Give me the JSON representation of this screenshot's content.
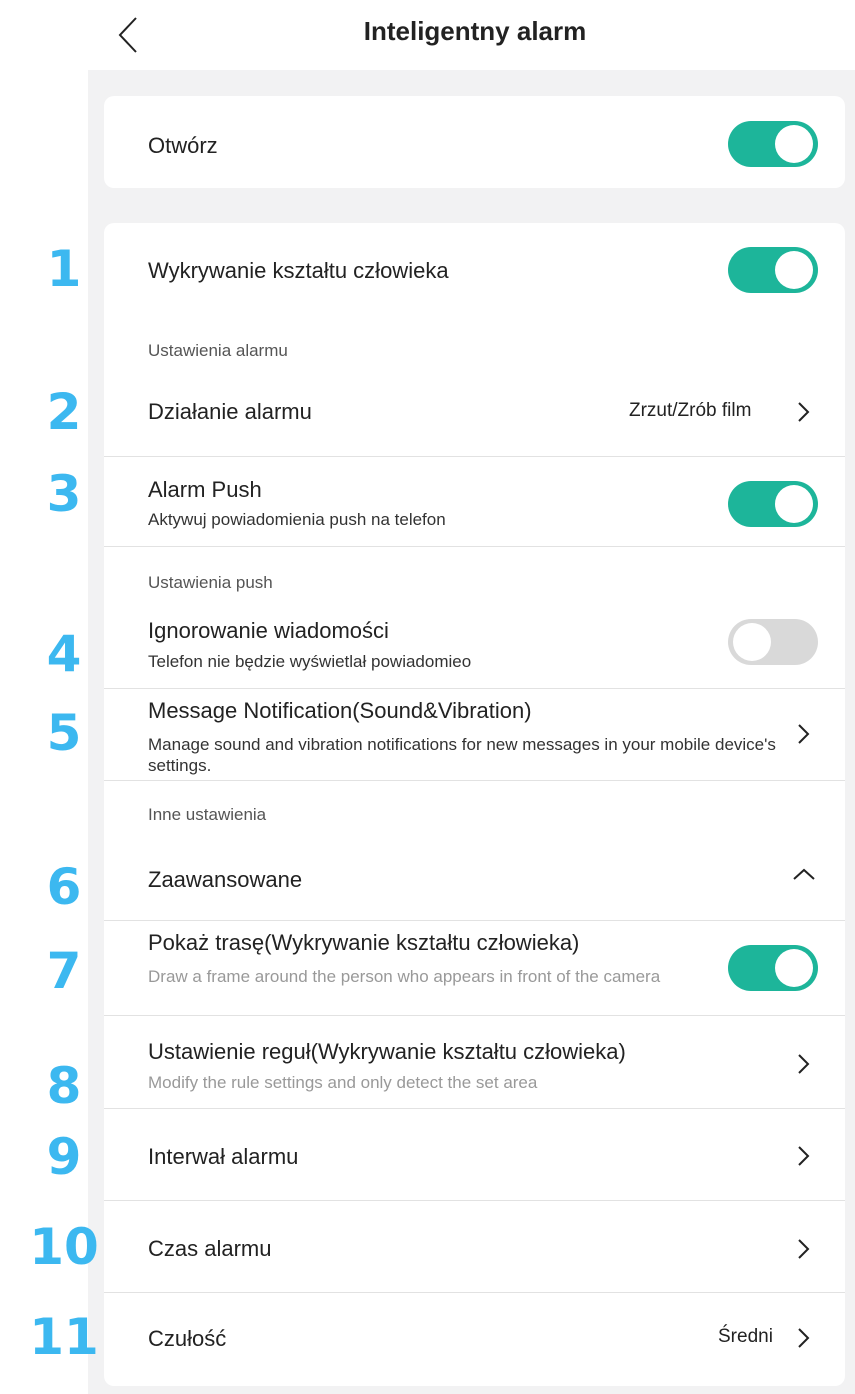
{
  "header": {
    "title": "Inteligentny alarm"
  },
  "open": {
    "label": "Otwórz",
    "state": "on"
  },
  "labels": [
    "1",
    "2",
    "3",
    "4",
    "5",
    "6",
    "7",
    "8",
    "9",
    "10",
    "11"
  ],
  "rows": {
    "human_detect": {
      "title": "Wykrywanie kształtu człowieka",
      "state": "on"
    },
    "alarm_settings_head": "Ustawienia alarmu",
    "alarm_action": {
      "title": "Działanie alarmu",
      "value": "Zrzut/Zrób film"
    },
    "alarm_push": {
      "title": "Alarm Push",
      "subtitle": "Aktywuj powiadomienia push na telefon",
      "state": "on"
    },
    "push_settings_head": "Ustawienia push",
    "ignore_messages": {
      "title": "Ignorowanie wiadomości",
      "subtitle": "Telefon nie będzie wyświetlał powiadomieo",
      "state": "off"
    },
    "message_notification": {
      "title": "Message Notification(Sound&Vibration)",
      "subtitle": "Manage sound and vibration notifications for new messages in your mobile device's settings."
    },
    "other_settings_head": "Inne ustawienia",
    "advanced": {
      "title": "Zaawansowane"
    },
    "show_track": {
      "title": "Pokaż trasę(Wykrywanie kształtu człowieka)",
      "subtitle": "Draw a frame around the person who appears in front of the camera",
      "state": "on"
    },
    "rule_settings": {
      "title": "Ustawienie reguł(Wykrywanie kształtu człowieka)",
      "subtitle": "Modify the rule settings and only detect the set area"
    },
    "alarm_interval": {
      "title": "Interwał alarmu"
    },
    "alarm_time": {
      "title": "Czas alarmu"
    },
    "sensitivity": {
      "title": "Czułość",
      "value": "Średni"
    }
  },
  "colors": {
    "toggle_on": "#1db59a",
    "toggle_off": "#d9d9d9",
    "label_numbers": "#3cb8f0",
    "page_bg": "#f2f2f3"
  }
}
